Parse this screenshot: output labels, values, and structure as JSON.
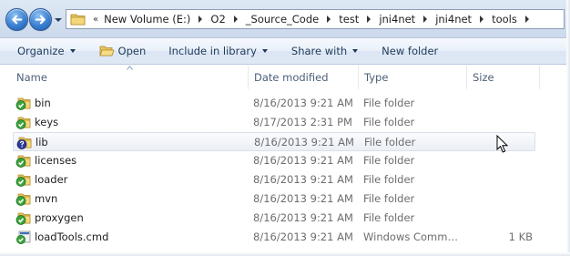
{
  "navigation": {
    "back_icon": "back-arrow-icon",
    "forward_icon": "forward-arrow-icon",
    "recent_icon": "dropdown-icon"
  },
  "address_bar": {
    "icon": "folder-icon",
    "overflow_chevron": "«",
    "crumbs": [
      "New Volume (E:)",
      "O2",
      "_Source_Code",
      "test",
      "jni4net",
      "jni4net",
      "tools"
    ]
  },
  "command_bar": {
    "organize": "Organize",
    "open": "Open",
    "include_in_library": "Include in library",
    "share_with": "Share with",
    "new_folder": "New folder"
  },
  "columns": {
    "name": "Name",
    "date_modified": "Date modified",
    "type": "Type",
    "size": "Size"
  },
  "files": [
    {
      "name": "bin",
      "date": "8/16/2013 9:21 AM",
      "type": "File folder",
      "size": "",
      "icon": "folder-svn-ok-icon"
    },
    {
      "name": "keys",
      "date": "8/17/2013 2:31 PM",
      "type": "File folder",
      "size": "",
      "icon": "folder-svn-ok-icon"
    },
    {
      "name": "lib",
      "date": "8/16/2013 9:21 AM",
      "type": "File folder",
      "size": "",
      "icon": "folder-svn-unknown-icon"
    },
    {
      "name": "licenses",
      "date": "8/16/2013 9:21 AM",
      "type": "File folder",
      "size": "",
      "icon": "folder-svn-ok-icon"
    },
    {
      "name": "loader",
      "date": "8/16/2013 9:21 AM",
      "type": "File folder",
      "size": "",
      "icon": "folder-svn-ok-icon"
    },
    {
      "name": "mvn",
      "date": "8/16/2013 9:21 AM",
      "type": "File folder",
      "size": "",
      "icon": "folder-svn-ok-icon"
    },
    {
      "name": "proxygen",
      "date": "8/16/2013 9:21 AM",
      "type": "File folder",
      "size": "",
      "icon": "folder-svn-ok-icon"
    },
    {
      "name": "loadTools.cmd",
      "date": "8/16/2013 9:21 AM",
      "type": "Windows Comma...",
      "size": "1 KB",
      "icon": "cmd-file-svn-ok-icon"
    }
  ],
  "colors": {
    "nav_bar_bg": "#cbd9ec",
    "command_text": "#1e395b",
    "header_text": "#4c607a",
    "detail_text": "#6d6d6d",
    "svn_ok_green": "#3aa43a",
    "svn_unknown_blue": "#2b3a9c"
  }
}
